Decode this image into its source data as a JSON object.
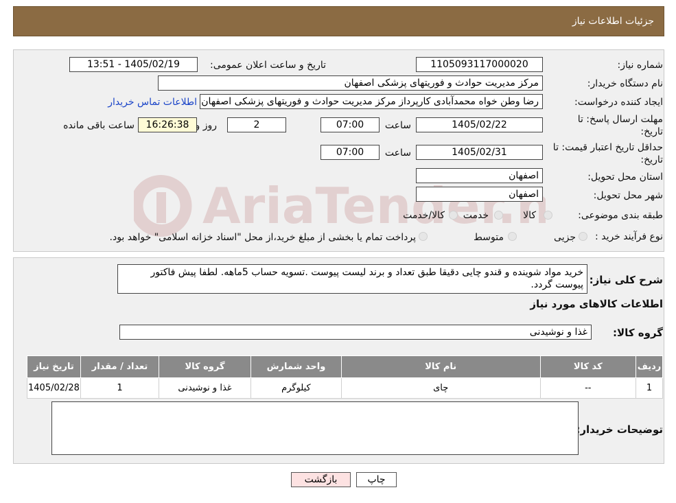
{
  "header": {
    "title": "جزئیات اطلاعات نیاز"
  },
  "form": {
    "need_number_label": "شماره نیاز:",
    "need_number": "1105093117000020",
    "announce_label": "تاریخ و ساعت اعلان عمومی:",
    "announce_value": "1405/02/19 - 13:51",
    "buyer_org_label": "نام دستگاه خریدار:",
    "buyer_org": "مرکز مدیریت حوادث و فوریتهای پزشکی اصفهان",
    "requester_label": "ایجاد کننده درخواست:",
    "requester": "رضا وطن خواه محمدآبادی کارپرداز مرکز مدیریت حوادث و فوریتهای پزشکی اصفهان",
    "contact_link": "اطلاعات تماس خریدار",
    "deadline_label_1": "مهلت ارسال پاسخ: تا",
    "deadline_label_2": "تاریخ:",
    "deadline_date": "1405/02/22",
    "time_label": "ساعت",
    "deadline_time": "07:00",
    "days_value": "2",
    "days_label": "روز و",
    "remaining_time": "16:26:38",
    "remaining_label": "ساعت باقی مانده",
    "validity_label_1": "حداقل تاریخ اعتبار قیمت: تا",
    "validity_label_2": "تاریخ:",
    "validity_date": "1405/02/31",
    "validity_time": "07:00",
    "province_label": "استان محل تحویل:",
    "province": "اصفهان",
    "city_label": "شهر محل تحویل:",
    "city": "اصفهان",
    "category_label": "طبقه بندی موضوعی:",
    "category_options": [
      "کالا",
      "خدمت",
      "کالا/خدمت"
    ],
    "process_label": "نوع فرآیند خرید :",
    "process_options": [
      "جزیی",
      "متوسط"
    ],
    "process_note": "پرداخت تمام یا بخشی از مبلغ خرید،از محل \"اسناد خزانه اسلامی\" خواهد بود."
  },
  "details": {
    "summary_label": "شرح کلی نیاز:",
    "summary": "خرید مواد شوینده و قندو چایی دقیقا طبق تعداد و برند لیست پیوست .تسویه حساب 5ماهه. لطفا پیش فاکتور پیوست گردد.",
    "goods_info_title": "اطلاعات کالاهای مورد نیاز",
    "goods_group_label": "گروه کالا:",
    "goods_group": "غذا و نوشیدنی",
    "table_headers": [
      "ردیف",
      "کد کالا",
      "نام کالا",
      "واحد شمارش",
      "گروه کالا",
      "تعداد / مقدار",
      "تاریخ نیاز"
    ],
    "table_rows": [
      [
        "1",
        "--",
        "چای",
        "کیلوگرم",
        "غذا و نوشیدنی",
        "1",
        "1405/02/28"
      ]
    ],
    "buyer_notes_label": "توضیحات خریدار:",
    "buyer_notes": ""
  },
  "buttons": {
    "print": "چاپ",
    "back": "بازگشت"
  },
  "watermark": {
    "text": "AriaTender.neT"
  },
  "colors": {
    "header": "#8b6b43",
    "table_header": "#8a8a8a",
    "link": "#1a44c8",
    "time_box": "#fffbd6",
    "back_button": "#fde2e2"
  }
}
